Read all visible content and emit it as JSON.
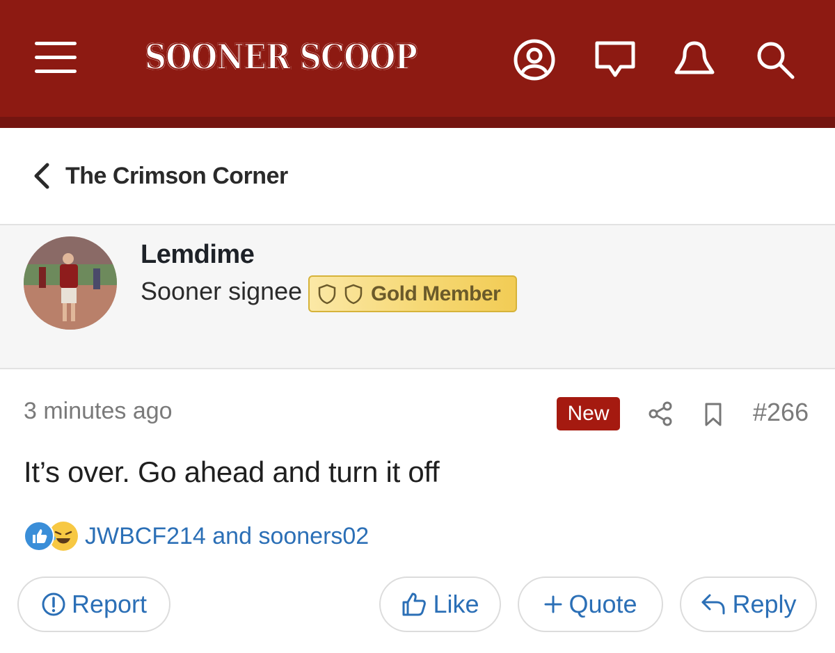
{
  "header": {
    "logo_text": "SOONER SCOOP",
    "background_color": "#8d1a12",
    "icons": [
      "menu-icon",
      "account-icon",
      "messages-icon",
      "alerts-icon",
      "search-icon"
    ]
  },
  "breadcrumb": {
    "label": "The Crimson Corner"
  },
  "user": {
    "name": "Lemdime",
    "title": "Sooner signee",
    "badge": "Gold Member"
  },
  "post": {
    "timestamp": "3 minutes ago",
    "new_label": "New",
    "number": "#266",
    "body": "It’s over. Go ahead and turn it off",
    "reaction_users": "JWBCF214 and sooners02"
  },
  "actions": {
    "report": "Report",
    "like": "Like",
    "quote": "Quote",
    "reply": "Reply"
  },
  "colors": {
    "brand": "#8d1a12",
    "new_badge": "#a51a10",
    "link": "#2b6fb6",
    "gold": "#f6d874"
  }
}
